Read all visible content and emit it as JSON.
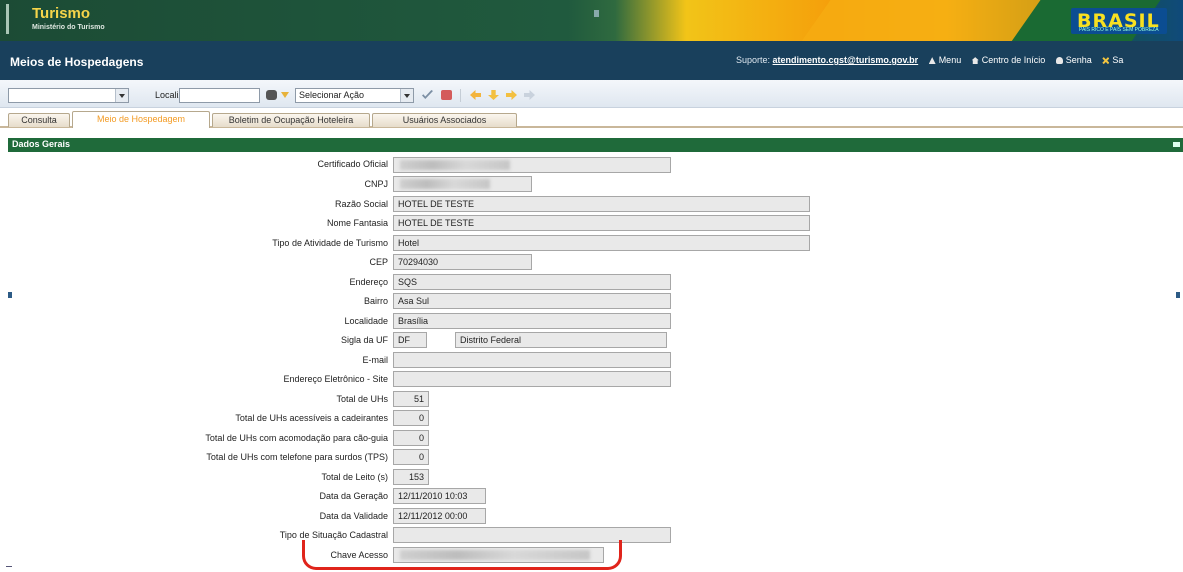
{
  "header": {
    "ministry_title": "Turismo",
    "ministry_subtitle": "Ministério do Turismo",
    "country_logo": "BRASIL",
    "country_tagline": "PAÍS RICO É PAÍS SEM POBREZA"
  },
  "titlebar": {
    "system_name": "Meios de Hospedagens",
    "support_label": "Suporte:",
    "support_email": "atendimento.cgst@turismo.gov.br",
    "menu_label": "Menu",
    "home_label": "Centro de Início",
    "password_label": "Senha",
    "exit_label": "Sa"
  },
  "toolbar": {
    "first_select_value": "",
    "find_label": "Localizar:",
    "find_value": "",
    "action_select_value": "Selecionar Ação",
    "icons": [
      "binoculars-icon",
      "dropdown-arrow-icon",
      "check-icon",
      "erase-icon",
      "first-arrow-icon",
      "down-arrow-icon",
      "next-arrow-icon",
      "last-arrow-icon"
    ]
  },
  "tabs": [
    {
      "label": "Consulta",
      "active": false
    },
    {
      "label": "Meio de Hospedagem",
      "active": true
    },
    {
      "label": "Boletim de Ocupação Hoteleira",
      "active": false
    },
    {
      "label": "Usuários Associados",
      "active": false
    }
  ],
  "section": {
    "title": "Dados Gerais"
  },
  "form": {
    "certificado_label": "Certificado Oficial",
    "cnpj_label": "CNPJ",
    "razao_label": "Razão Social",
    "razao_value": "HOTEL DE TESTE",
    "fantasia_label": "Nome Fantasia",
    "fantasia_value": "HOTEL DE TESTE",
    "tipo_atividade_label": "Tipo de Atividade de Turismo",
    "tipo_atividade_value": "Hotel",
    "cep_label": "CEP",
    "cep_value": "70294030",
    "endereco_label": "Endereço",
    "endereco_value": "SQS",
    "bairro_label": "Bairro",
    "bairro_value": "Asa Sul",
    "localidade_label": "Localidade",
    "localidade_value": "Brasília",
    "uf_label": "Sigla da UF",
    "uf_value": "DF",
    "uf_name_value": "Distrito Federal",
    "email_label": "E-mail",
    "email_value": "",
    "site_label": "Endereço Eletrônico - Site",
    "site_value": "",
    "total_uhs_label": "Total de UHs",
    "total_uhs_value": "51",
    "uhs_cadeirantes_label": "Total de UHs acessíveis a cadeirantes",
    "uhs_cadeirantes_value": "0",
    "uhs_caoguia_label": "Total de UHs com acomodação para cão-guia",
    "uhs_caoguia_value": "0",
    "uhs_tps_label": "Total de UHs com telefone para surdos (TPS)",
    "uhs_tps_value": "0",
    "leitos_label": "Total de Leito (s)",
    "leitos_value": "153",
    "geracao_label": "Data da Geração",
    "geracao_value": "12/11/2010 10:03",
    "validade_label": "Data da Validade",
    "validade_value": "12/11/2012 00:00",
    "situacao_label": "Tipo de Situação Cadastral",
    "situacao_value": "",
    "chave_label": "Chave Acesso"
  },
  "colors": {
    "title_bar": "#19405c",
    "section_header": "#1f6a3a",
    "active_tab_text": "#f39b24",
    "highlight_marker": "#e0241b"
  }
}
